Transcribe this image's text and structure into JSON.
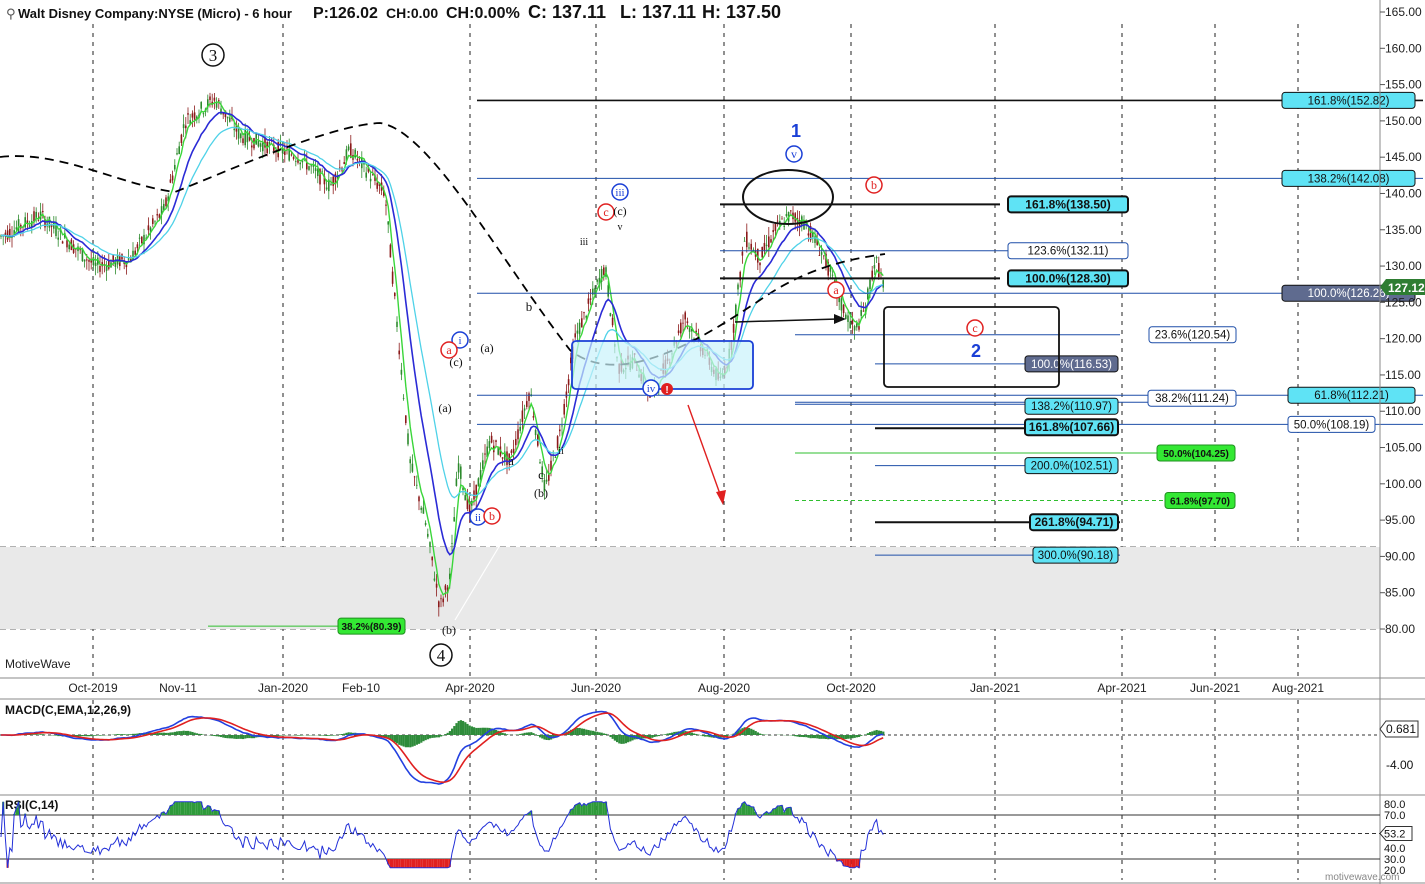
{
  "header": {
    "title": "Walt Disney Company:NYSE (Micro) - 6 hour",
    "price": "P:126.02",
    "change": "CH:0.00",
    "change_pct": "CH:0.00%",
    "close": "C: 137.11",
    "low": "L: 137.11",
    "high": "H: 137.50"
  },
  "watermark": "MotiveWave",
  "footer_logo": "motivewave.com",
  "price_axis": {
    "ticks": [
      "165.00",
      "160.00",
      "155.00",
      "150.00",
      "145.00",
      "140.00",
      "135.00",
      "130.00",
      "125.00",
      "120.00",
      "115.00",
      "110.00",
      "105.00",
      "100.00",
      "95.00",
      "90.00",
      "85.00",
      "80.00"
    ],
    "tick_values": [
      165,
      160,
      155,
      150,
      145,
      140,
      135,
      130,
      125,
      120,
      115,
      110,
      105,
      100,
      95,
      90,
      85,
      80
    ],
    "last_price": "127.12",
    "last_price_value": 127.12
  },
  "time_axis": {
    "labels": [
      "Oct-2019",
      "Nov-11",
      "Jan-2020",
      "Feb-10",
      "Apr-2020",
      "Jun-2020",
      "Aug-2020",
      "Oct-2020",
      "Jan-2021",
      "Apr-2021",
      "Jun-2021",
      "Aug-2021"
    ]
  },
  "macd": {
    "title": "MACD(C,EMA,12,26,9)",
    "ticks": [
      "0.681",
      "-4.00"
    ],
    "tick_values": [
      0.681,
      -4
    ]
  },
  "rsi": {
    "title": "RSI(C,14)",
    "ticks": [
      "80.0",
      "70.0",
      "53.2",
      "40.0",
      "30.0",
      "20.0"
    ],
    "tick_values": [
      80,
      70,
      53.2,
      40,
      30,
      20
    ]
  },
  "fib_levels": [
    {
      "label": "161.8%(152.82)",
      "value": 152.82,
      "style": "cyan-right"
    },
    {
      "label": "138.2%(142.08)",
      "value": 142.08,
      "style": "cyan-right"
    },
    {
      "label": "161.8%(138.50)",
      "value": 138.5,
      "style": "cyan-bold"
    },
    {
      "label": "123.6%(132.11)",
      "value": 132.11,
      "style": "white"
    },
    {
      "label": "100.0%(128.30)",
      "value": 128.3,
      "style": "cyan-bold"
    },
    {
      "label": "100.0%(126.26)",
      "value": 126.26,
      "style": "gray-right"
    },
    {
      "label": "23.6%(120.54)",
      "value": 120.54,
      "style": "white"
    },
    {
      "label": "100.0%(116.53)",
      "value": 116.53,
      "style": "gray"
    },
    {
      "label": "61.8%(112.21)",
      "value": 112.21,
      "style": "cyan-right"
    },
    {
      "label": "138.2%(110.97)",
      "value": 110.97,
      "style": "cyan"
    },
    {
      "label": "38.2%(111.24)",
      "value": 111.24,
      "style": "white"
    },
    {
      "label": "50.0%(108.19)",
      "value": 108.19,
      "style": "white"
    },
    {
      "label": "161.8%(107.66)",
      "value": 107.66,
      "style": "cyan-bold"
    },
    {
      "label": "50.0%(104.25)",
      "value": 104.25,
      "style": "green"
    },
    {
      "label": "200.0%(102.51)",
      "value": 102.51,
      "style": "cyan"
    },
    {
      "label": "61.8%(97.70)",
      "value": 97.7,
      "style": "green"
    },
    {
      "label": "261.8%(94.71)",
      "value": 94.71,
      "style": "cyan-bold"
    },
    {
      "label": "300.0%(90.18)",
      "value": 90.18,
      "style": "cyan"
    },
    {
      "label": "38.2%(80.39)",
      "value": 80.39,
      "style": "green"
    }
  ],
  "wave_labels": {
    "w3": "3",
    "w4": "4",
    "w1": "1",
    "w2": "2",
    "v": "v",
    "iii": "iii",
    "iv": "iv",
    "ii": "ii",
    "i": "i",
    "c": "c",
    "b": "b",
    "a": "a",
    "pc": "(c)",
    "pa": "(a)",
    "pb": "(b)",
    "sm_iii": "iii",
    "sm_v": "v",
    "sm_ii": "ii",
    "sm_a": "a",
    "sm_b": "b",
    "sm_c": "c"
  },
  "colors": {
    "candle_up": "#2d8a2d",
    "candle_down": "#8b1a1a",
    "ma_fast": "#3ad63a",
    "ma_mid": "#2b2bd6",
    "ma_slow": "#4fd2e8",
    "trend": "#000000",
    "fib_blue": "#1f4fa8",
    "cyan_box": "#5fe3f5",
    "green_box": "#33e833",
    "gray_box": "#5f6b8f",
    "red": "#e02020",
    "blue": "#1a3fd6"
  },
  "chart_data": {
    "type": "candlestick",
    "symbol": "DIS",
    "series": [
      {
        "name": "Price",
        "t": [
          0,
          14,
          28,
          42,
          56,
          70,
          84,
          98,
          112,
          126,
          140,
          154,
          168,
          182,
          196,
          210,
          224,
          238,
          252,
          266,
          280,
          294,
          308,
          322,
          336,
          350,
          364,
          378,
          392,
          406,
          420,
          434,
          440,
          448,
          456,
          464,
          478,
          492,
          506,
          520,
          534,
          548,
          562,
          576,
          590,
          604,
          618,
          632,
          646,
          660,
          674,
          688,
          702,
          716,
          730,
          744,
          758,
          772,
          786,
          800,
          814,
          828,
          842,
          856,
          870,
          884
        ],
        "v": [
          134,
          136,
          139,
          137,
          132,
          131,
          133,
          132,
          131,
          133,
          140,
          150,
          153,
          149,
          147,
          146,
          147,
          146,
          144,
          140,
          139,
          133,
          120,
          106,
          95,
          90,
          87,
          90,
          99,
          104,
          110,
          114,
          117,
          121,
          126,
          124,
          116,
          113,
          117,
          118,
          115,
          122,
          118,
          117,
          114,
          116,
          128,
          131,
          133,
          135,
          134,
          135,
          136,
          134,
          128,
          124,
          122,
          127,
          133,
          126,
          128,
          125,
          127,
          127,
          127,
          127
        ]
      }
    ],
    "macd_ticks": [
      0.681,
      -4
    ],
    "rsi_ticks": [
      80,
      70,
      53.2,
      40,
      30,
      20
    ]
  }
}
